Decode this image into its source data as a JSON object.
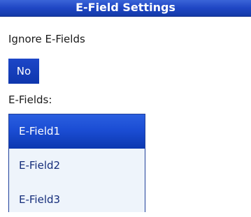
{
  "header": {
    "title": "E-Field Settings"
  },
  "ignore_efields": {
    "label": "Ignore E-Fields",
    "value": "No"
  },
  "efields": {
    "label": "E-Fields:",
    "items": [
      {
        "label": "E-Field1",
        "selected": true
      },
      {
        "label": "E-Field2",
        "selected": false
      },
      {
        "label": "E-Field3",
        "selected": false
      }
    ]
  },
  "colors": {
    "accent": "#1f46c4",
    "list_background": "#eef4fb",
    "list_text": "#142c7a"
  }
}
